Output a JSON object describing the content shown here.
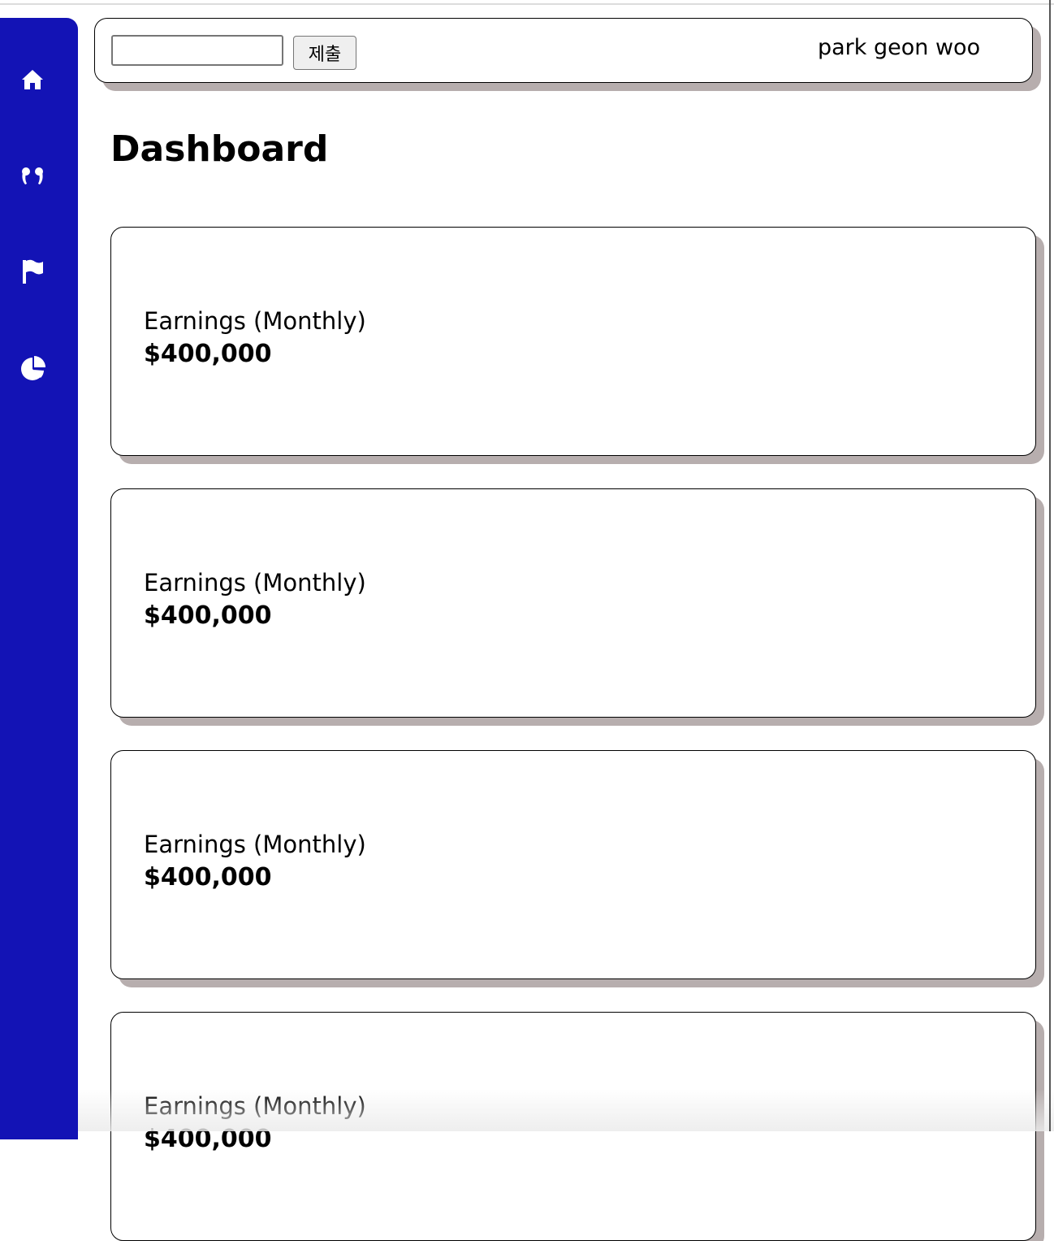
{
  "sidebar": {
    "color": "#1313b5",
    "items": [
      {
        "icon": "home-icon"
      },
      {
        "icon": "quote-icon"
      },
      {
        "icon": "flag-icon"
      },
      {
        "icon": "pie-chart-icon"
      }
    ]
  },
  "header": {
    "search": {
      "value": "",
      "placeholder": ""
    },
    "submit_label": "제출",
    "user_name": "park geon woo"
  },
  "main": {
    "title": "Dashboard",
    "cards": [
      {
        "label": "Earnings (Monthly)",
        "value": "$400,000"
      },
      {
        "label": "Earnings (Monthly)",
        "value": "$400,000"
      },
      {
        "label": "Earnings (Monthly)",
        "value": "$400,000"
      },
      {
        "label": "Earnings (Monthly)",
        "value": "$400,000"
      }
    ]
  },
  "colors": {
    "card_shadow": "#b7aeae",
    "sidebar": "#1313b5"
  }
}
